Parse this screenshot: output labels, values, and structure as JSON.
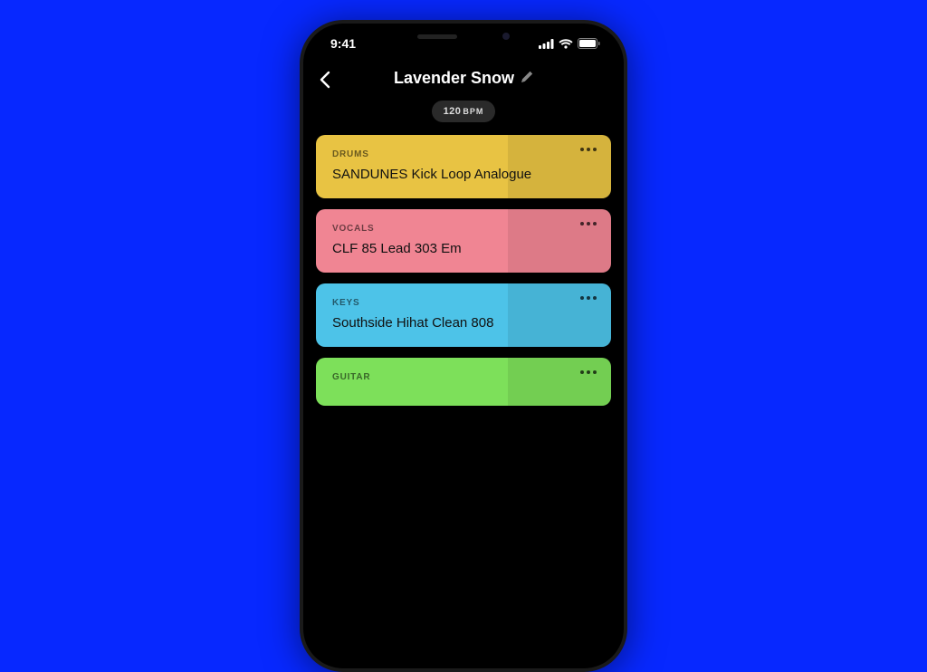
{
  "status_bar": {
    "time": "9:41"
  },
  "header": {
    "title": "Lavender Snow"
  },
  "bpm": {
    "value": "120",
    "unit": "BPM"
  },
  "tracks": [
    {
      "category": "DRUMS",
      "name": "SANDUNES Kick Loop Analogue",
      "color": "drums"
    },
    {
      "category": "VOCALS",
      "name": "CLF 85 Lead 303 Em",
      "color": "vocals"
    },
    {
      "category": "KEYS",
      "name": "Southside Hihat Clean 808",
      "color": "keys"
    },
    {
      "category": "GUITAR",
      "name": "",
      "color": "guitar"
    }
  ]
}
